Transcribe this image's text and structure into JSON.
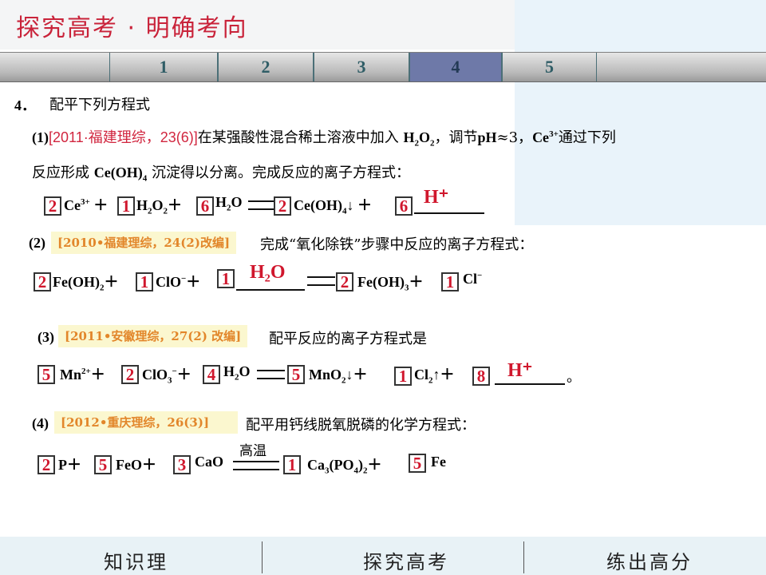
{
  "header": {
    "title": "探究高考 · 明确考向"
  },
  "tabs": [
    "1",
    "2",
    "3",
    "4",
    "5"
  ],
  "active_tab": "4",
  "question": {
    "number": "4．",
    "prompt": "配平下列方程式"
  },
  "part1": {
    "tag": "(1)",
    "source": "[2011·福建理综，23(6)]",
    "line1_a": "在某强酸性混合稀土溶液中加入",
    "line1_b": "，调节",
    "line1_c": "≈3，",
    "line1_d": "通过下列",
    "line2_a": "反应形成",
    "line2_b": "沉淀得以分离。完成反应的离子方程式：",
    "coefficients": [
      "2",
      "1",
      "6",
      "2",
      "6"
    ],
    "answer": "H⁺"
  },
  "part2": {
    "tag": "(2)",
    "source": "[2010•福建理综，24(2)改编]",
    "text": "完成“氧化除铁”步骤中反应的离子方程式：",
    "coefficients": [
      "2",
      "1",
      "1",
      "2",
      "1"
    ],
    "answer": "H₂O"
  },
  "part3": {
    "tag": "(3)",
    "source": "[2011•安徽理综，27(2) 改编]",
    "text": "配平反应的离子方程式是",
    "coefficients": [
      "5",
      "2",
      "4",
      "5",
      "1",
      "8"
    ],
    "answer": "H⁺",
    "end": "。"
  },
  "part4": {
    "tag": "(4)",
    "source": "[2012•重庆理综，26(3)]",
    "text": "配平用钙线脱氧脱磷的化学方程式：",
    "condition": "高温",
    "coefficients": [
      "2",
      "5",
      "3",
      "1",
      "5"
    ]
  },
  "footer": {
    "left": "知识理",
    "middle": "探究高考",
    "right": "练出高分"
  }
}
